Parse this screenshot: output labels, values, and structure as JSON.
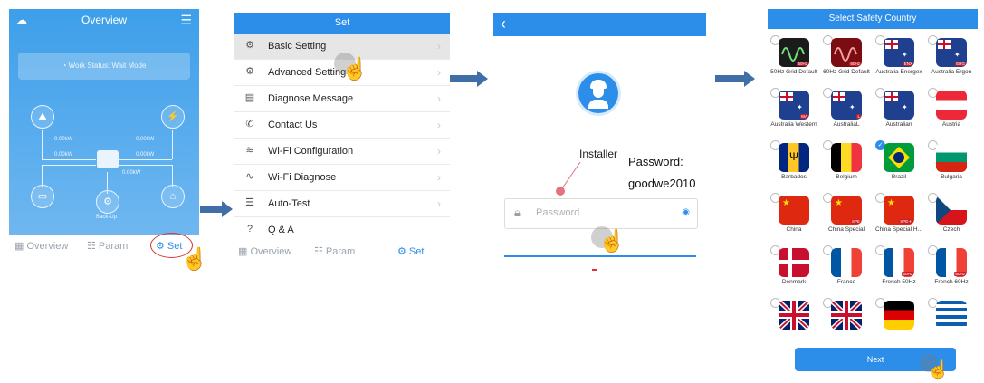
{
  "screen1": {
    "title": "Overview",
    "status": "Work Status: Wait Mode",
    "kw1": "0.00kW",
    "kw2": "0.00kW",
    "kw3": "0.00kW",
    "kw4": "0.00kW",
    "kw5": "0.00kW",
    "backup": "Back-Up",
    "nav": [
      "Overview",
      "Param",
      "Set"
    ]
  },
  "screen2": {
    "title": "Set",
    "items": [
      "Basic Setting",
      "Advanced Setting",
      "Diagnose Message",
      "Contact Us",
      "Wi-Fi Configuration",
      "Wi-Fi Diagnose",
      "Auto-Test",
      "Q & A"
    ],
    "nav": [
      "Overview",
      "Param",
      "Set"
    ]
  },
  "screen3": {
    "role": "Installer",
    "password_placeholder": "Password",
    "annotation_line1": "Password:",
    "annotation_line2": "goodwe2010"
  },
  "screen4": {
    "title": "Select Safety Country",
    "countries": [
      {
        "name": "50Hz Grid Default",
        "tag": "50Hz"
      },
      {
        "name": "60Hz Grid Default",
        "tag": "60Hz"
      },
      {
        "name": "Australia Energex",
        "tag": "ENX"
      },
      {
        "name": "Australia Ergon",
        "tag": "ERG"
      },
      {
        "name": "Australia Western",
        "tag": "WA"
      },
      {
        "name": "AustraliaL",
        "tag": "L"
      },
      {
        "name": "Australian",
        "tag": ""
      },
      {
        "name": "Austria",
        "tag": ""
      },
      {
        "name": "Barbados",
        "tag": ""
      },
      {
        "name": "Belgium",
        "tag": ""
      },
      {
        "name": "Brazil",
        "tag": ""
      },
      {
        "name": "Bulgaria",
        "tag": ""
      },
      {
        "name": "China",
        "tag": ""
      },
      {
        "name": "China Special",
        "tag": "SPE"
      },
      {
        "name": "China Special H...",
        "tag": "SPE-H"
      },
      {
        "name": "Czech",
        "tag": ""
      },
      {
        "name": "Denmark",
        "tag": ""
      },
      {
        "name": "France",
        "tag": ""
      },
      {
        "name": "French 50Hz",
        "tag": "50Hz"
      },
      {
        "name": "French 60Hz",
        "tag": "60Hz"
      },
      {
        "name": "",
        "tag": ""
      },
      {
        "name": "",
        "tag": ""
      },
      {
        "name": "",
        "tag": ""
      },
      {
        "name": "",
        "tag": ""
      }
    ],
    "next": "Next"
  },
  "colors": {
    "accent": "#2d8eea",
    "arrow": "#3f6fa6",
    "annotation": "#d9534f"
  }
}
